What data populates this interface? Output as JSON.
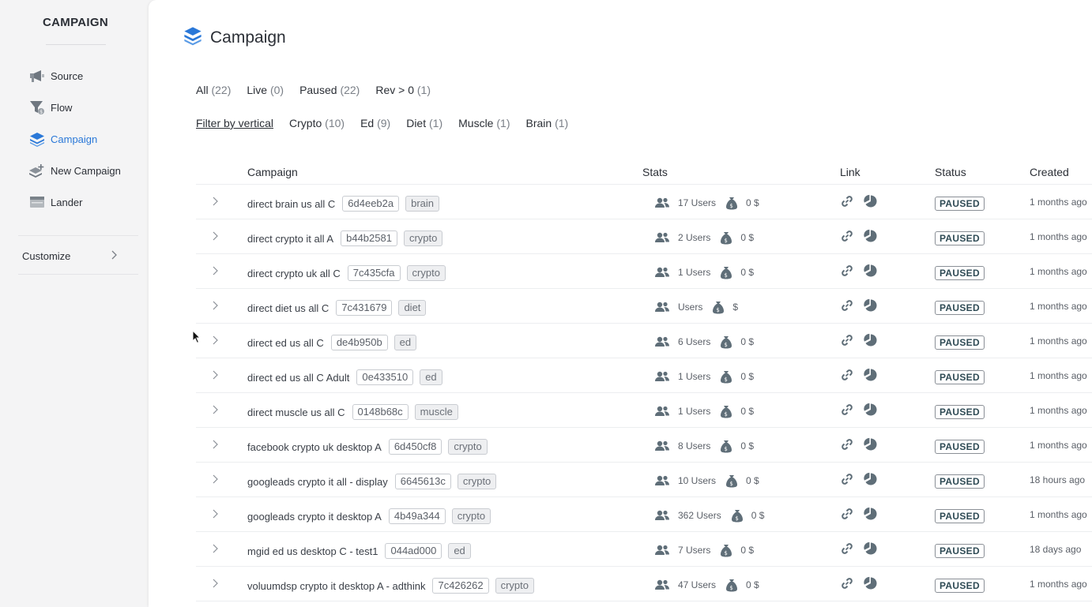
{
  "sidebar": {
    "brand": "CAMPAIGN",
    "items": [
      {
        "label": "Source",
        "icon": "megaphone-icon"
      },
      {
        "label": "Flow",
        "icon": "funnel-icon"
      },
      {
        "label": "Campaign",
        "icon": "layers-icon",
        "active": true
      },
      {
        "label": "New Campaign",
        "icon": "layers-add-icon"
      },
      {
        "label": "Lander",
        "icon": "window-icon"
      }
    ],
    "customize": "Customize"
  },
  "header": {
    "title": "Campaign",
    "icon": "layers-icon"
  },
  "tabs": [
    {
      "label": "All",
      "count": "(22)"
    },
    {
      "label": "Live",
      "count": "(0)"
    },
    {
      "label": "Paused",
      "count": "(22)"
    },
    {
      "label": "Rev > 0",
      "count": "(1)"
    }
  ],
  "filters": {
    "label": "Filter by vertical",
    "items": [
      {
        "label": "Crypto",
        "count": "(10)"
      },
      {
        "label": "Ed",
        "count": "(9)"
      },
      {
        "label": "Diet",
        "count": "(1)"
      },
      {
        "label": "Muscle",
        "count": "(1)"
      },
      {
        "label": "Brain",
        "count": "(1)"
      }
    ]
  },
  "table": {
    "columns": {
      "campaign": "Campaign",
      "stats": "Stats",
      "link": "Link",
      "status": "Status",
      "created": "Created"
    },
    "rows": [
      {
        "name": "direct brain us all C",
        "hash": "6d4eeb2a",
        "tag": "brain",
        "users": "17 Users",
        "revenue": "0 $",
        "status": "PAUSED",
        "created": "1 months ago"
      },
      {
        "name": "direct crypto it all A",
        "hash": "b44b2581",
        "tag": "crypto",
        "users": "2 Users",
        "revenue": "0 $",
        "status": "PAUSED",
        "created": "1 months ago"
      },
      {
        "name": "direct crypto uk all C",
        "hash": "7c435cfa",
        "tag": "crypto",
        "users": "1 Users",
        "revenue": "0 $",
        "status": "PAUSED",
        "created": "1 months ago"
      },
      {
        "name": "direct diet us all C",
        "hash": "7c431679",
        "tag": "diet",
        "users": "Users",
        "revenue": "$",
        "status": "PAUSED",
        "created": "1 months ago"
      },
      {
        "name": "direct ed us all C",
        "hash": "de4b950b",
        "tag": "ed",
        "users": "6 Users",
        "revenue": "0 $",
        "status": "PAUSED",
        "created": "1 months ago"
      },
      {
        "name": "direct ed us all C Adult",
        "hash": "0e433510",
        "tag": "ed",
        "users": "1 Users",
        "revenue": "0 $",
        "status": "PAUSED",
        "created": "1 months ago"
      },
      {
        "name": "direct muscle us all C",
        "hash": "0148b68c",
        "tag": "muscle",
        "users": "1 Users",
        "revenue": "0 $",
        "status": "PAUSED",
        "created": "1 months ago"
      },
      {
        "name": "facebook crypto uk desktop A",
        "hash": "6d450cf8",
        "tag": "crypto",
        "users": "8 Users",
        "revenue": "0 $",
        "status": "PAUSED",
        "created": "1 months ago"
      },
      {
        "name": "googleads crypto it all - display",
        "hash": "6645613c",
        "tag": "crypto",
        "users": "10 Users",
        "revenue": "0 $",
        "status": "PAUSED",
        "created": "18 hours ago"
      },
      {
        "name": "googleads crypto it desktop A",
        "hash": "4b49a344",
        "tag": "crypto",
        "users": "362 Users",
        "revenue": "0 $",
        "status": "PAUSED",
        "created": "1 months ago"
      },
      {
        "name": "mgid ed us desktop C - test1",
        "hash": "044ad000",
        "tag": "ed",
        "users": "7 Users",
        "revenue": "0 $",
        "status": "PAUSED",
        "created": "18 days ago"
      },
      {
        "name": "voluumdsp crypto it desktop A - adthink",
        "hash": "7c426262",
        "tag": "crypto",
        "users": "47 Users",
        "revenue": "0 $",
        "status": "PAUSED",
        "created": "1 months ago"
      }
    ]
  },
  "colors": {
    "accent": "#2a78d8",
    "text": "#2b2f36",
    "muted": "#7a7f87",
    "icon": "#5f6e78"
  }
}
